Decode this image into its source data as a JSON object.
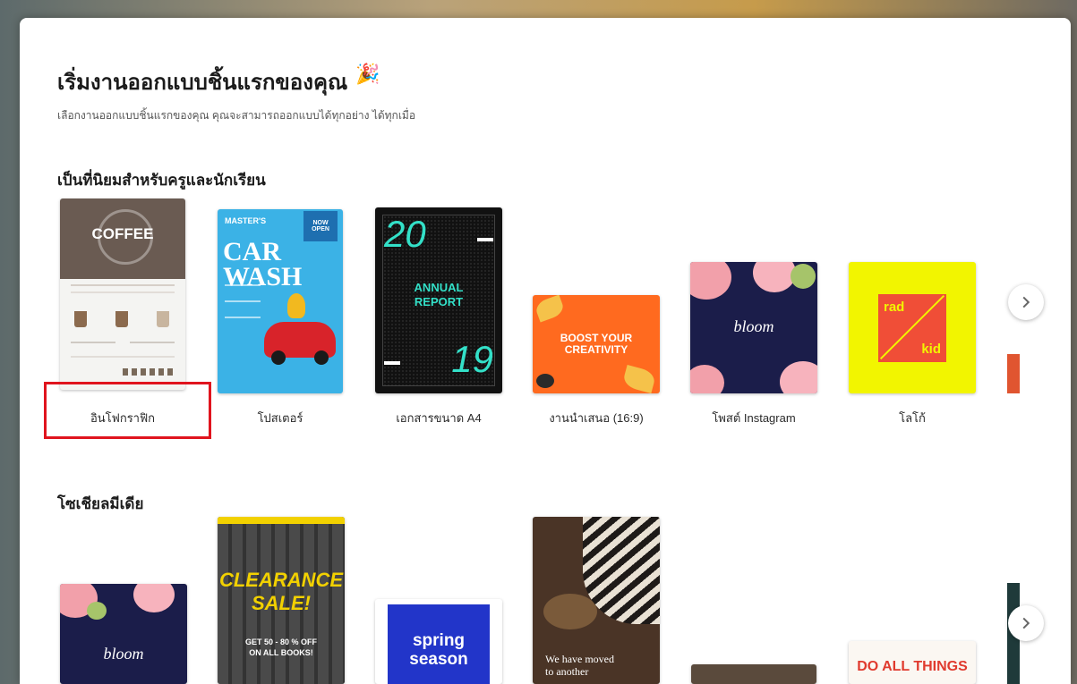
{
  "modal": {
    "title": "เริ่มงานออกแบบชิ้นแรกของคุณ",
    "title_icon": "party-popper-icon",
    "subtitle": "เลือกงานออกแบบชิ้นแรกของคุณ คุณจะสามารถออกแบบได้ทุกอย่าง ได้ทุกเมื่อ"
  },
  "popular": {
    "heading": "เป็นที่นิยมสำหรับครูและนักเรียน",
    "items": [
      {
        "label": "อินโฟกราฟิก",
        "thumb": {
          "headline": "COFFEE"
        }
      },
      {
        "label": "โปสเตอร์",
        "thumb": {
          "headline": "CAR WASH",
          "badge_top": "NOW",
          "badge_bottom": "OPEN",
          "kicker": "MASTER'S"
        }
      },
      {
        "label": "เอกสารขนาด A4",
        "thumb": {
          "year_top": "20",
          "year_bottom": "19",
          "headline_1": "ANNUAL",
          "headline_2": "REPORT"
        }
      },
      {
        "label": "งานนำเสนอ (16:9)",
        "thumb": {
          "headline_1": "BOOST YOUR",
          "headline_2": "CREATIVITY"
        }
      },
      {
        "label": "โพสต์ Instagram",
        "thumb": {
          "headline": "bloom"
        }
      },
      {
        "label": "โลโก้",
        "thumb": {
          "word_1": "rad",
          "word_2": "kid"
        }
      }
    ]
  },
  "social": {
    "heading": "โซเชียลมีเดีย",
    "items": [
      {
        "thumb": {
          "headline": "bloom"
        }
      },
      {
        "thumb": {
          "headline_1": "CLEARANCE",
          "headline_2": "SALE!",
          "sub_1": "GET 50 - 80 % OFF",
          "sub_2": "ON ALL BOOKS!"
        }
      },
      {
        "thumb": {
          "headline_1": "spring",
          "headline_2": "season"
        }
      },
      {
        "thumb": {
          "headline_1": "We have moved",
          "headline_2": "to another"
        }
      },
      {
        "thumb": {}
      },
      {
        "thumb": {
          "headline": "DO ALL THINGS"
        }
      }
    ]
  },
  "colors": {
    "highlight": "#e0141e",
    "coffee_bg": "#6a5b52",
    "poster_bg": "#3bb2e6",
    "report_bg": "#111111",
    "report_accent": "#33e0c8",
    "presentation_bg": "#ff6a1f",
    "bloom_bg": "#1b1d4a",
    "logo_bg": "#f2f500",
    "logo_box": "#f04e37",
    "spring_bg": "#2235c9"
  }
}
